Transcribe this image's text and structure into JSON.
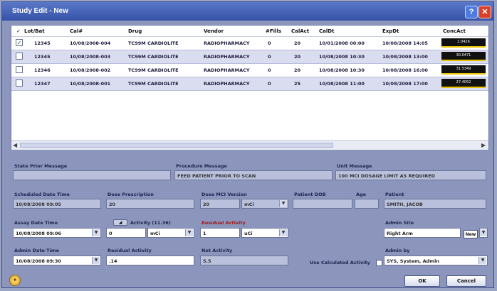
{
  "window": {
    "title": "Study Edit - New"
  },
  "grid": {
    "headers": [
      "Lot/Bat",
      "Cal#",
      "Drug",
      "Vendor",
      "#Fills",
      "CalAct",
      "CalDt",
      "ExpDt",
      "ConcAct"
    ],
    "check_header": "✓",
    "rows": [
      {
        "lot": "12345",
        "cal": "10/08/2008-004",
        "drug": "TC99M CARDIOLITE",
        "vendor": "RADIOPHARMACY",
        "fills": "0",
        "calact": "20",
        "caldt": "10/01/2008 00:00",
        "expdt": "10/08/2008 14:05",
        "conc": "2.0426",
        "checked": true
      },
      {
        "lot": "12345",
        "cal": "10/08/2008-003",
        "drug": "TC99M CARDIOLITE",
        "vendor": "RADIOPHARMACY",
        "fills": "0",
        "calact": "20",
        "caldt": "10/08/2008 10:30",
        "expdt": "10/08/2008 13:00",
        "conc": "30.0471",
        "checked": false
      },
      {
        "lot": "12346",
        "cal": "10/08/2008-002",
        "drug": "TC99M CARDIOLITE",
        "vendor": "RADIOPHARMACY",
        "fills": "0",
        "calact": "20",
        "caldt": "10/08/2008 10:30",
        "expdt": "10/08/2008 16:00",
        "conc": "31.5349",
        "checked": false
      },
      {
        "lot": "12347",
        "cal": "10/08/2008-001",
        "drug": "TC99M CARDIOLITE",
        "vendor": "RADIOPHARMACY",
        "fills": "0",
        "calact": "25",
        "caldt": "10/08/2008 11:00",
        "expdt": "10/08/2008 17:00",
        "conc": "27.4052",
        "checked": false
      }
    ]
  },
  "info": {
    "state_label": "State Prior Message",
    "state_value": "",
    "procedure_label": "Procedure Message",
    "procedure_value": "FEED PATIENT PRIOR TO SCAN",
    "unit_label": "Unit Message",
    "unit_value": "100 MCI DOSAGE LIMIT AS REQUIRED"
  },
  "fields": {
    "sched_dt_label": "Scheduled Date Time",
    "sched_dt_value": "10/08/2008 09:05",
    "dose_pres_label": "Dose Prescription",
    "dose_pres_value": "20",
    "dose_mci_label": "Dose MCI Version",
    "dose_mci_value": "20",
    "dose_unit": "mCi",
    "pat_dob_label": "Patient DOB",
    "pat_dob_value": "",
    "age_label": "Age",
    "age_value": "",
    "patient_label": "Patient",
    "patient_value": "SMITH, JACOB",
    "assay_dt_label": "Assay Date Time",
    "assay_dt_value": "10/08/2008 09:06",
    "act_label": "Activity (11.36)",
    "act_value": "0",
    "act_unit": "mCi",
    "res_label": "Residual Activity",
    "res_value": "1",
    "res_unit": "uCi",
    "admin_site_label": "Admin Site",
    "admin_site_value": "Right Arm",
    "new_label": "New",
    "admin_dt_label": "Admin Date Time",
    "admin_dt_value": "10/08/2008 09:30",
    "admin_act_label": "Residual Activity",
    "admin_act_value": ".14",
    "net_act_label": "Net Activity",
    "net_act_value": "5.5",
    "report_label": "Use Calculated Activity",
    "admin_by_label": "Admin by",
    "admin_by_value": "SYS, System, Admin"
  },
  "buttons": {
    "ok": "OK",
    "cancel": "Cancel"
  },
  "colors": {
    "title_bar": "#3e5cb0",
    "close": "#d9402a",
    "row_alt": "#dadcef"
  }
}
